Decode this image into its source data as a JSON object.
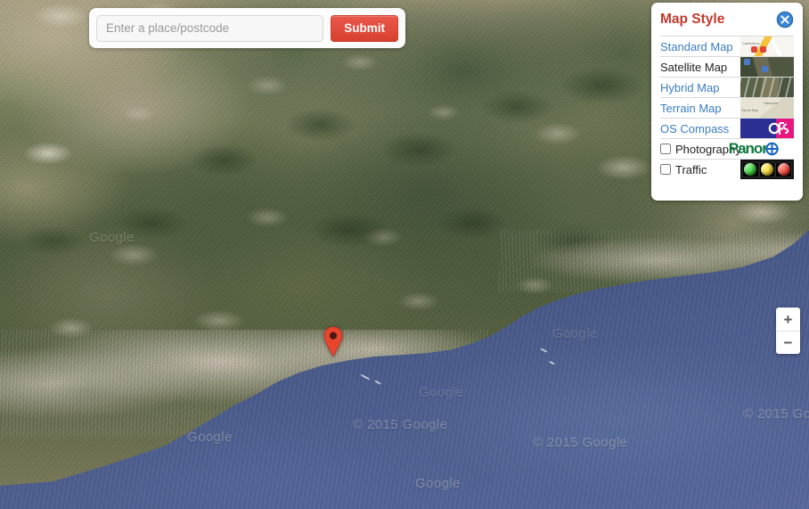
{
  "search": {
    "placeholder": "Enter a place/postcode",
    "value": "",
    "submit_label": "Submit"
  },
  "map": {
    "type": "satellite",
    "marker_label": "location-marker",
    "attribution": "© 2015 Google",
    "watermarks": [
      "© 2015 Google",
      "© 2015 Google",
      "© 2015 Google",
      "© 2015 Google",
      "© 2015 Google",
      "Google",
      "Google",
      "Google",
      "© 2015 Go"
    ],
    "zoom_in_label": "+",
    "zoom_out_label": "−"
  },
  "style_panel": {
    "title": "Map Style",
    "close_label": "×",
    "styles": [
      {
        "label": "Standard Map",
        "active": false,
        "thumb": "standard-map-thumbnail"
      },
      {
        "label": "Satellite Map",
        "active": true,
        "thumb": "satellite-map-thumbnail"
      },
      {
        "label": "Hybrid Map",
        "active": false,
        "thumb": "hybrid-map-thumbnail"
      },
      {
        "label": "Terrain Map",
        "active": false,
        "thumb": "terrain-map-thumbnail"
      },
      {
        "label": "OS Compass",
        "active": false,
        "thumb": "os-compass-thumbnail"
      }
    ],
    "overlays": [
      {
        "label": "Photography",
        "checked": false,
        "thumb": "panoramio-logo-thumbnail"
      },
      {
        "label": "Traffic",
        "checked": false,
        "thumb": "traffic-lights-thumbnail"
      }
    ]
  },
  "colors": {
    "panel_title": "#c0392b",
    "link": "#3b7dc4",
    "active_text": "#222222",
    "submit_button": "#d8402f",
    "marker": "#e8452f",
    "close_button": "#3b87d4",
    "sea": "#4b5c8c"
  }
}
